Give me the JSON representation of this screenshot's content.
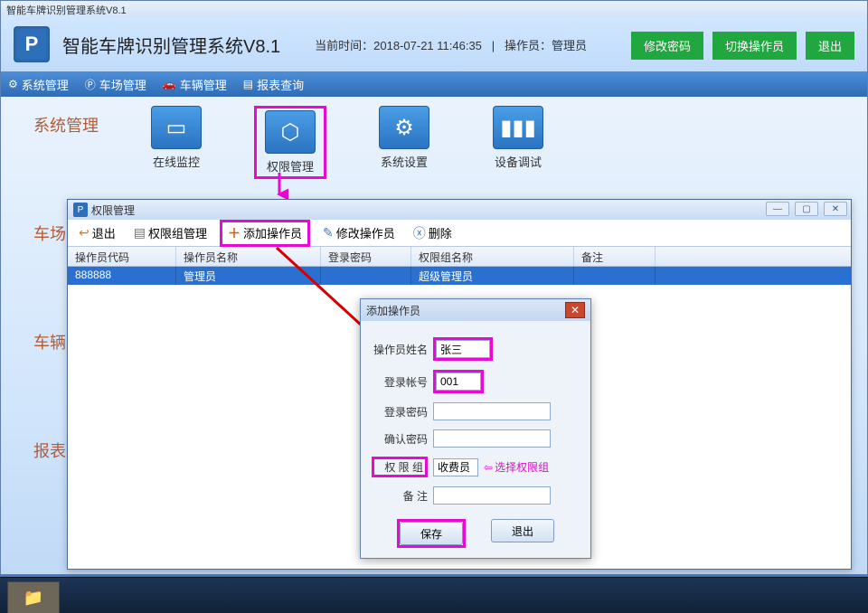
{
  "window_title": "智能车牌识别管理系统V8.1",
  "header": {
    "app_title": "智能车牌识别管理系统V8.1",
    "time_label": "当前时间：2018-07-21 11:46:35",
    "operator_label": "操作员：管理员",
    "btn_change_pwd": "修改密码",
    "btn_switch_operator": "切换操作员",
    "btn_exit": "退出"
  },
  "nav": {
    "system": "系统管理",
    "park": "车场管理",
    "vehicle": "车辆管理",
    "report": "报表查询"
  },
  "sections": {
    "system": "系统管理",
    "park": "车场",
    "vehicle": "车辆",
    "report": "报表"
  },
  "tiles": {
    "online_monitor": "在线监控",
    "permission_mgmt": "权限管理",
    "system_settings": "系统设置",
    "device_debug": "设备调试"
  },
  "subwin": {
    "title": "权限管理",
    "toolbar": {
      "exit": "退出",
      "group_mgmt": "权限组管理",
      "add_operator": "添加操作员",
      "edit_operator": "修改操作员",
      "delete": "删除"
    },
    "columns": {
      "code": "操作员代码",
      "name": "操作员名称",
      "pwd": "登录密码",
      "group": "权限组名称",
      "remark": "备注"
    },
    "rows": [
      {
        "code": "888888",
        "name": "管理员",
        "pwd": "",
        "group": "超级管理员",
        "remark": ""
      }
    ]
  },
  "dialog": {
    "title": "添加操作员",
    "labels": {
      "op_name": "操作员姓名",
      "account": "登录帐号",
      "pwd": "登录密码",
      "confirm_pwd": "确认密码",
      "perm_group": "权 限 组",
      "remark": "备  注"
    },
    "values": {
      "op_name": "张三",
      "account": "001",
      "pwd": "",
      "confirm_pwd": "",
      "perm_group": "收费员",
      "remark": ""
    },
    "hint_select_group": "选择权限组",
    "btn_save": "保存",
    "btn_exit": "退出"
  },
  "sysmenu": {
    "min": "—",
    "max": "▢",
    "close": "✕"
  }
}
